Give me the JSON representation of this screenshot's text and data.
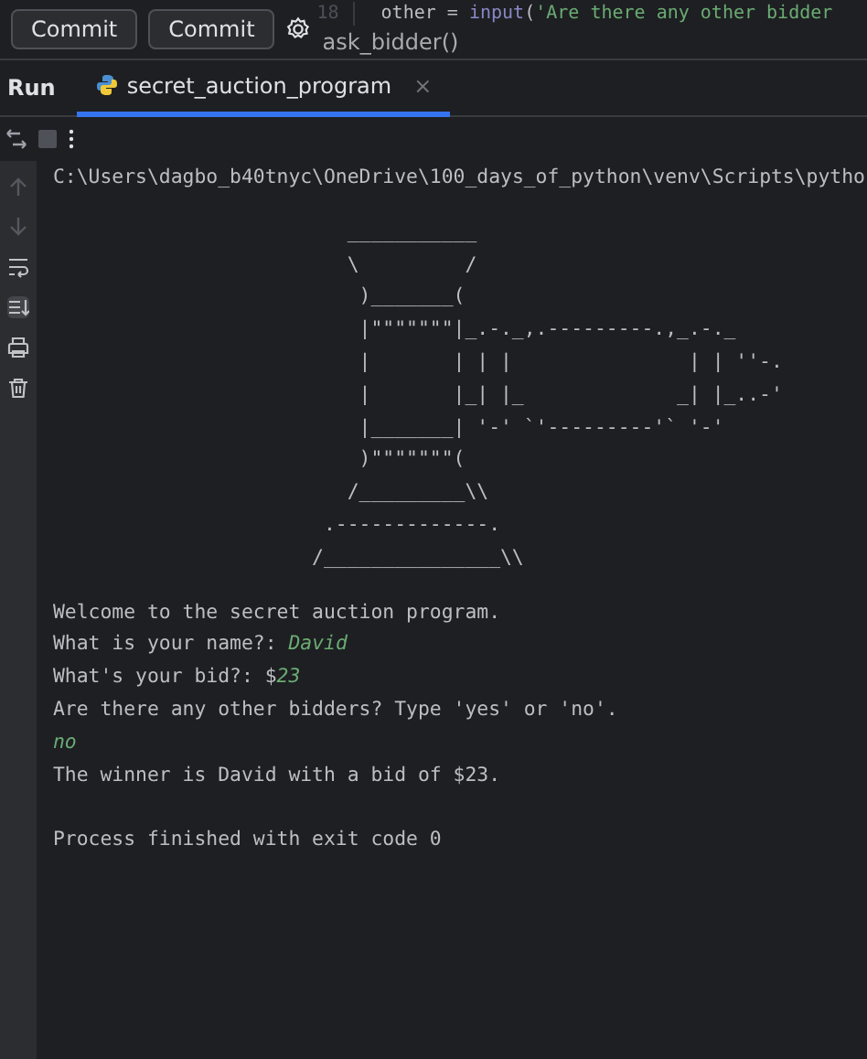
{
  "top_bar": {
    "buttons": [
      "Commit",
      "Commit"
    ],
    "editor": {
      "line_number": "18",
      "code": [
        {
          "text": "other = ",
          "kind": "plain"
        },
        {
          "text": "input",
          "kind": "builtin"
        },
        {
          "text": "(",
          "kind": "plain"
        },
        {
          "text": "'Are there any other bidder",
          "kind": "string"
        }
      ]
    },
    "breadcrumb": "ask_bidder()"
  },
  "run_panel": {
    "title": "Run",
    "tabs": [
      {
        "label": "secret_auction_program",
        "selected": true,
        "close": "×"
      }
    ]
  },
  "console": {
    "command": "C:\\Users\\dagbo_b40tnyc\\OneDrive\\100_days_of_python\\venv\\Scripts\\pytho",
    "art": [
      "   ___________",
      "   \\         /",
      "    )_______(",
      "    |\"\"\"\"\"\"\"|_.-._,.---------.,_.-._",
      "    |       | | |               | | ''-.",
      "    |       |_| |_             _| |_..-'",
      "    |_______| '-' `'---------'` '-'",
      "    )\"\"\"\"\"\"\"(",
      "   /_________\\\\",
      " .-------------.",
      "/_______________\\\\"
    ],
    "lines": [
      {
        "kind": "text",
        "segments": [
          {
            "text": "Welcome to the secret auction program.",
            "input": false
          }
        ]
      },
      {
        "kind": "text",
        "segments": [
          {
            "text": "What is your name?: ",
            "input": false
          },
          {
            "text": "David",
            "input": true
          }
        ]
      },
      {
        "kind": "text",
        "segments": [
          {
            "text": "What's your bid?: $",
            "input": false
          },
          {
            "text": "23",
            "input": true
          }
        ]
      },
      {
        "kind": "text",
        "segments": [
          {
            "text": "Are there any other bidders? Type 'yes' or 'no'.",
            "input": false
          }
        ]
      },
      {
        "kind": "text",
        "segments": [
          {
            "text": "no",
            "input": true
          }
        ]
      },
      {
        "kind": "text",
        "segments": [
          {
            "text": "The winner is David with a bid of $23.",
            "input": false
          }
        ]
      },
      {
        "kind": "blank"
      },
      {
        "kind": "text",
        "segments": [
          {
            "text": "Process finished with exit code 0",
            "input": false
          }
        ]
      }
    ]
  }
}
